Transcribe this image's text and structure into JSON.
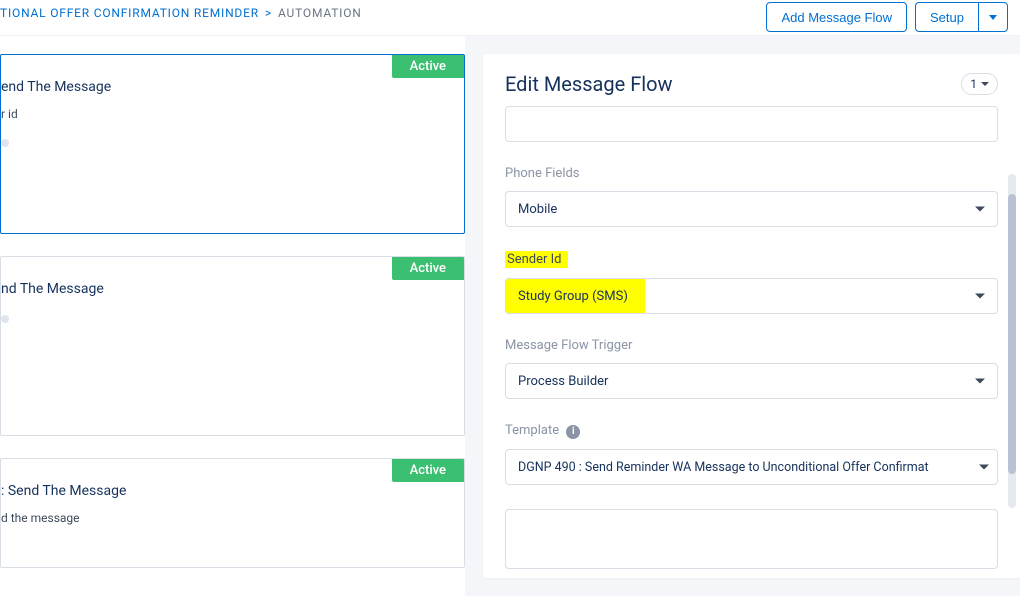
{
  "header": {
    "breadcrumb": {
      "link": "TIONAL OFFER CONFIRMATION REMINDER",
      "current": "AUTOMATION"
    },
    "buttons": {
      "add_flow": "Add Message Flow",
      "setup": "Setup"
    }
  },
  "left": {
    "cards": [
      {
        "title": "end The Message",
        "sub": "r id",
        "status": "Active",
        "selected": true,
        "dot": true
      },
      {
        "title": "nd The Message",
        "sub": "",
        "status": "Active",
        "selected": false,
        "dot": true
      },
      {
        "title": ": Send The Message",
        "sub": "d the message",
        "status": "Active",
        "selected": false,
        "dot": false
      }
    ]
  },
  "panel": {
    "title": "Edit Message Flow",
    "version": "1",
    "fields": {
      "phone_fields_label": "Phone Fields",
      "phone_fields_value": "Mobile",
      "sender_id_label": "Sender Id",
      "sender_id_value": "Study Group (SMS)",
      "trigger_label": "Message Flow Trigger",
      "trigger_value": "Process Builder",
      "template_label": "Template",
      "template_value": "DGNP 490 : Send Reminder WA Message to Unconditional Offer Confirmat"
    }
  }
}
